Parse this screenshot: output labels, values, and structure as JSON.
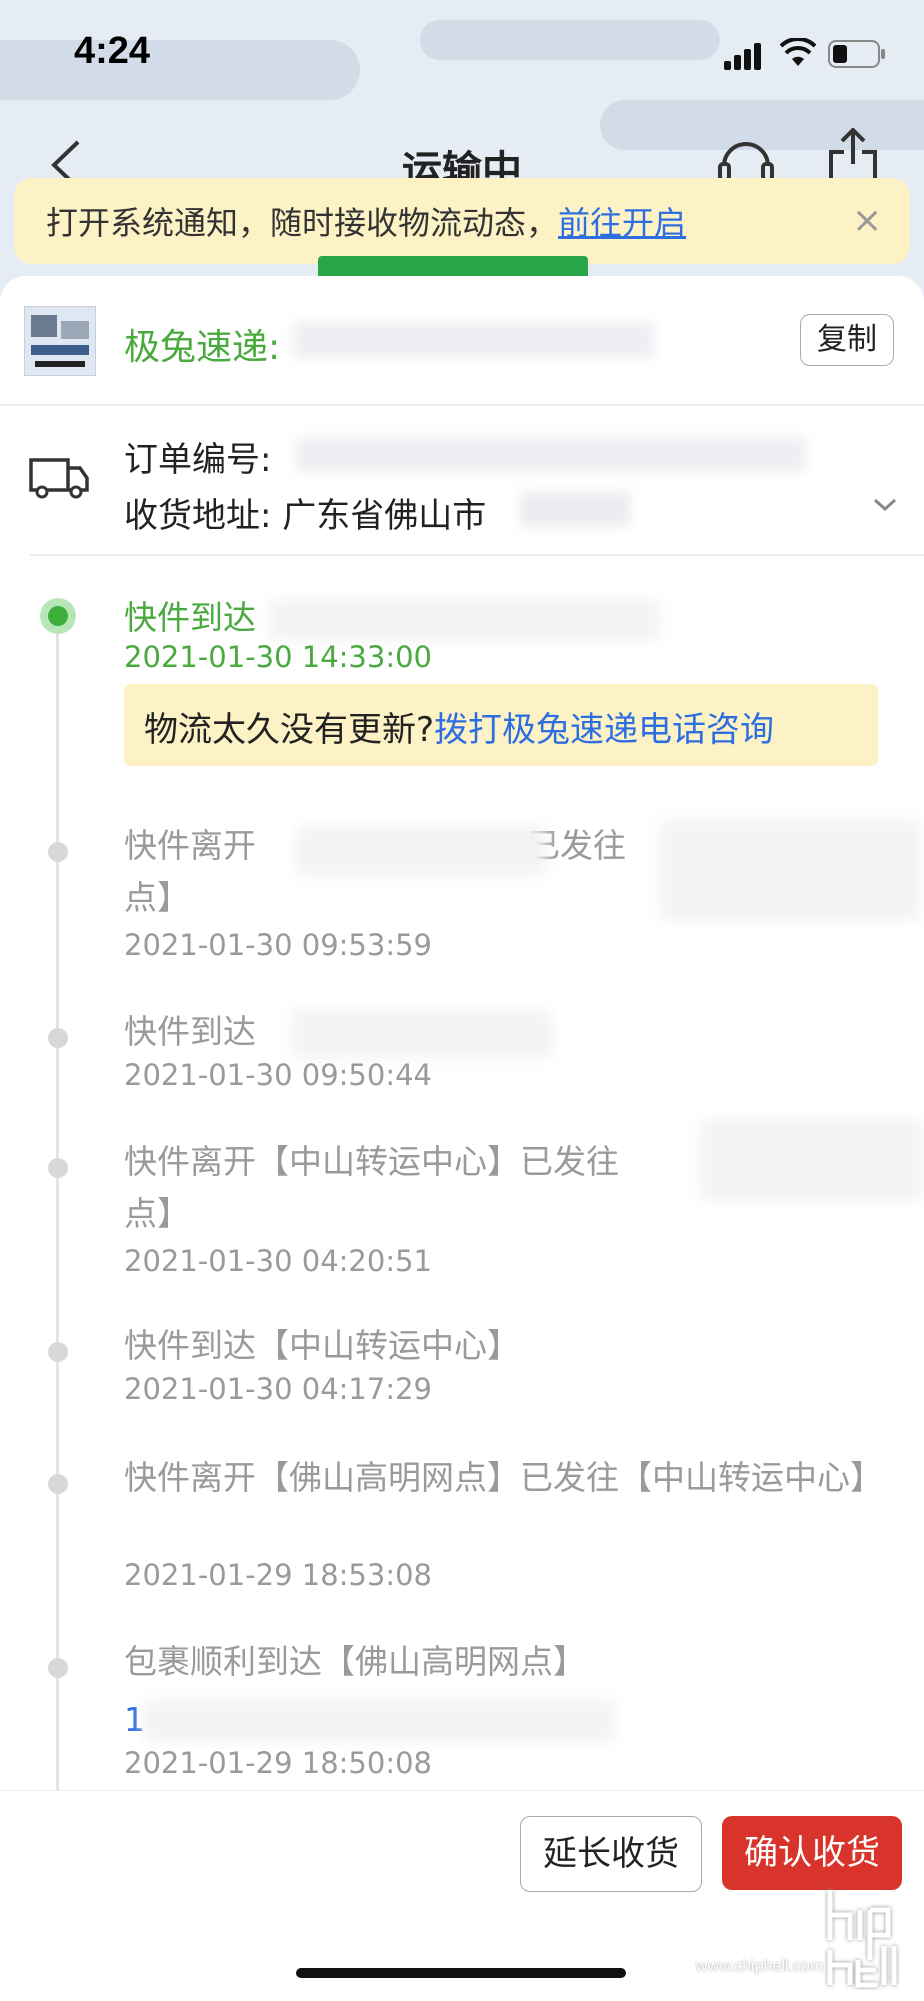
{
  "status_bar": {
    "time": "4:24"
  },
  "nav": {
    "title": "运输中"
  },
  "banner": {
    "text": "打开系统通知，随时接收物流动态，",
    "link": "前往开启",
    "close": "×"
  },
  "carrier": {
    "name": "极兔速递:",
    "copy_label": "复制"
  },
  "order": {
    "order_label": "订单编号:",
    "address_label": "收货地址:",
    "address_value": "广东省佛山市"
  },
  "help": {
    "question": "物流太久没有更新?",
    "link": "拨打极兔速递电话咨询"
  },
  "events": [
    {
      "text": "快件到达",
      "time": "2021-01-30 14:33:00",
      "active": true
    },
    {
      "text": "快件离开",
      "text2": "已发往",
      "text3": "点】",
      "time": "2021-01-30 09:53:59"
    },
    {
      "text": "快件到达",
      "time": "2021-01-30 09:50:44"
    },
    {
      "text": "快件离开【中山转运中心】已发往",
      "text3": "点】",
      "time": "2021-01-30 04:20:51"
    },
    {
      "text": "快件到达【中山转运中心】",
      "time": "2021-01-30 04:17:29"
    },
    {
      "text": "快件离开【佛山高明网点】已发往【中山转运中心】",
      "time": "2021-01-29 18:53:08"
    },
    {
      "text": "包裹顺利到达【佛山高明网点】",
      "phone": "1",
      "time": "2021-01-29 18:50:08"
    }
  ],
  "actions": {
    "extend": "延长收货",
    "confirm": "确认收货"
  },
  "watermark": {
    "text": "www.chiphell.com"
  },
  "colors": {
    "green": "#4aaa3f",
    "link_blue": "#2d6fe0",
    "confirm_red": "#d8342b",
    "banner_yellow": "#fdf2c5"
  }
}
